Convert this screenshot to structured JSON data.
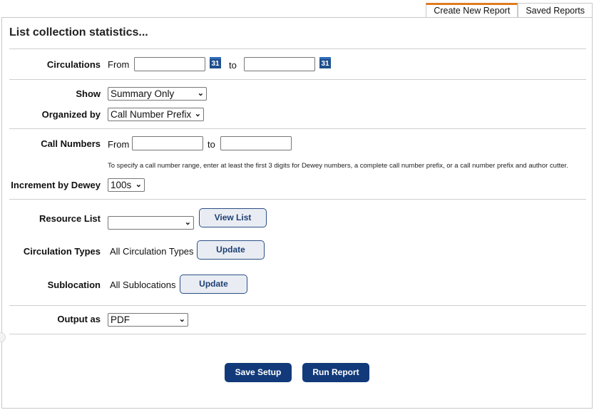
{
  "tabs": {
    "create_new_report": "Create New Report",
    "saved_reports": "Saved Reports"
  },
  "page": {
    "title": "List collection statistics..."
  },
  "circulations": {
    "label": "Circulations",
    "from_label": "From",
    "to_label": "to",
    "from_value": "",
    "to_value": "",
    "calendar_text": "31"
  },
  "show": {
    "label": "Show",
    "selected": "Summary Only"
  },
  "organized_by": {
    "label": "Organized by",
    "selected": "Call Number Prefix"
  },
  "call_numbers": {
    "label": "Call Numbers",
    "from_label": "From",
    "to_label": "to",
    "from_value": "",
    "to_value": "",
    "hint": "To specify a call number range, enter at least the first 3 digits for Dewey numbers, a complete call number prefix, or a call number prefix and author cutter."
  },
  "increment_by_dewey": {
    "label": "Increment by Dewey",
    "selected": "100s"
  },
  "resource_list": {
    "label": "Resource List",
    "selected": "",
    "button": "View List"
  },
  "circulation_types": {
    "label": "Circulation Types",
    "value": "All Circulation Types",
    "button": "Update"
  },
  "sublocation": {
    "label": "Sublocation",
    "value": "All Sublocations",
    "button": "Update"
  },
  "output_as": {
    "label": "Output as",
    "selected": "PDF"
  },
  "actions": {
    "save_setup": "Save Setup",
    "run_report": "Run Report"
  },
  "colors": {
    "tab_accent": "#e07b1f",
    "primary_button": "#123a7a",
    "calendar_icon": "#1f4f8c"
  }
}
